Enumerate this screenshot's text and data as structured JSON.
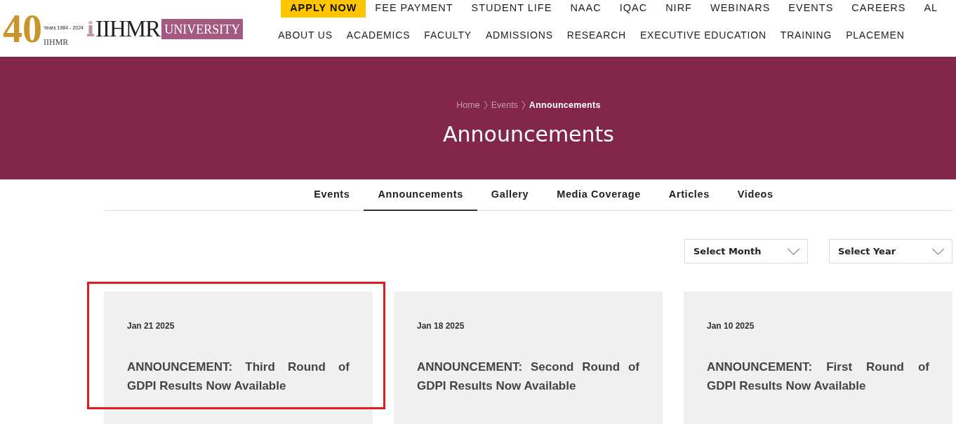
{
  "logo": {
    "anniversary_number": "40",
    "anniversary_years": "Years 1984 - 2024",
    "anniversary_name": "IIHMR",
    "wordmark": "IIHMR",
    "wordmark_suffix": "UNIVERSITY"
  },
  "top_nav": [
    {
      "label": "APPLY NOW",
      "kind": "highlight"
    },
    {
      "label": "FEE PAYMENT",
      "kind": "link"
    },
    {
      "label": "STUDENT LIFE",
      "kind": "link"
    },
    {
      "label": "NAAC",
      "kind": "link"
    },
    {
      "label": "IQAC",
      "kind": "link"
    },
    {
      "label": "NIRF",
      "kind": "link"
    },
    {
      "label": "WEBINARS",
      "kind": "link"
    },
    {
      "label": "EVENTS",
      "kind": "link"
    },
    {
      "label": "CAREERS",
      "kind": "link"
    },
    {
      "label": "AL",
      "kind": "link"
    }
  ],
  "main_nav": [
    "ABOUT US",
    "ACADEMICS",
    "FACULTY",
    "ADMISSIONS",
    "RESEARCH",
    "EXECUTIVE EDUCATION",
    "TRAINING",
    "PLACEMEN"
  ],
  "banner": {
    "breadcrumb": [
      {
        "label": "Home",
        "current": false
      },
      {
        "label": "Events",
        "current": false
      },
      {
        "label": "Announcements",
        "current": true
      }
    ],
    "title": "Announcements"
  },
  "tabs": [
    {
      "label": "Events",
      "selected": false
    },
    {
      "label": "Announcements",
      "selected": true
    },
    {
      "label": "Gallery",
      "selected": false
    },
    {
      "label": "Media Coverage",
      "selected": false
    },
    {
      "label": "Articles",
      "selected": false
    },
    {
      "label": "Videos",
      "selected": false
    }
  ],
  "filters": [
    {
      "placeholder": "Select Month"
    },
    {
      "placeholder": "Select Year"
    }
  ],
  "cards": [
    {
      "date": "Jan 21 2025",
      "title": "ANNOUNCEMENT: Third Round of GDPI Results Now Available",
      "highlighted": true
    },
    {
      "date": "Jan 18 2025",
      "title": "ANNOUNCEMENT: Second Round of GDPI Results Now Available",
      "highlighted": false
    },
    {
      "date": "Jan 10 2025",
      "title": "ANNOUNCEMENT: First Round of GDPI Results Now Available",
      "highlighted": false
    }
  ]
}
